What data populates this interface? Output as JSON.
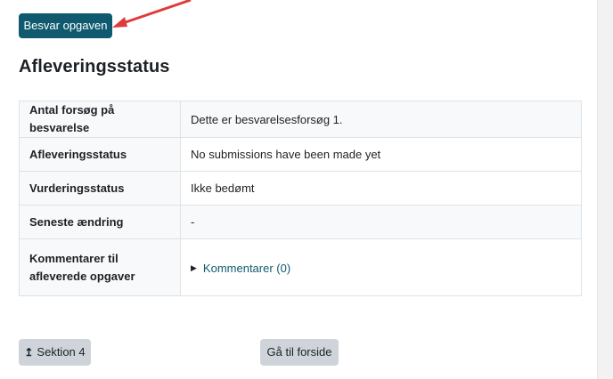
{
  "answer_button": {
    "label": "Besvar opgaven"
  },
  "section_title": "Afleveringsstatus",
  "status_table": [
    {
      "key": "Antal forsøg på besvarelse",
      "value": "Dette er besvarelsesforsøg 1."
    },
    {
      "key": "Afleveringsstatus",
      "value": "No submissions have been made yet"
    },
    {
      "key": "Vurderingsstatus",
      "value": "Ikke bedømt"
    },
    {
      "key": "Seneste ændring",
      "value": "-"
    },
    {
      "key": "Kommentarer til afleverede opgaver",
      "value": "Kommentarer (0)"
    }
  ],
  "footer": {
    "section_button": {
      "icon": "↥",
      "label": "Sektion 4"
    },
    "home_button": {
      "label": "Gå til forside"
    }
  },
  "colors": {
    "primary": "#0f5a6e",
    "secondary": "#ced4da",
    "annotation_arrow": "#e03b3b"
  },
  "icons": [
    "up-arrow-icon",
    "caret-right-icon"
  ]
}
